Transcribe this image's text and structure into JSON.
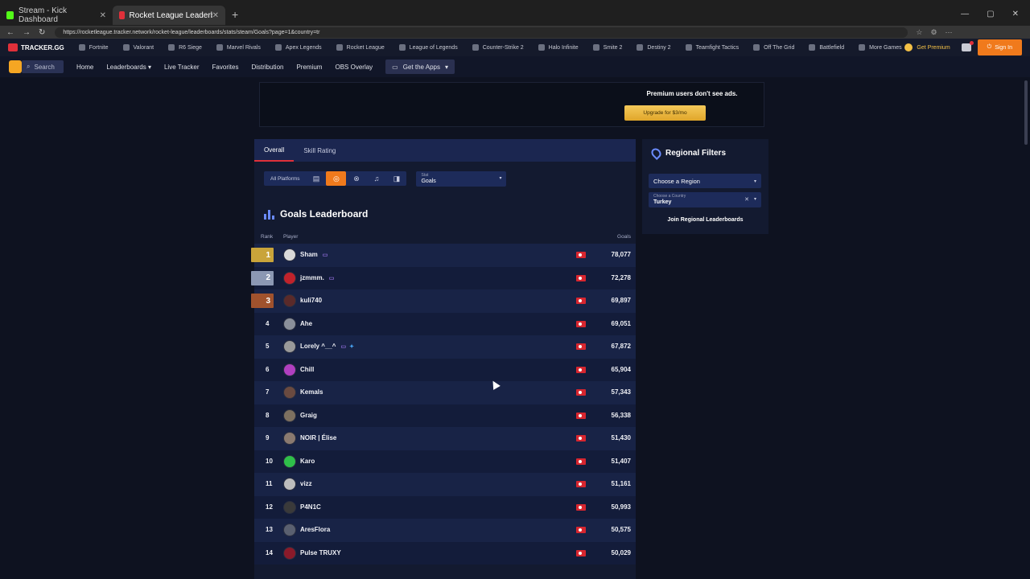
{
  "browser": {
    "tabs": [
      {
        "title": "Stream - Kick Dashboard",
        "color": "#53fc18",
        "active": false
      },
      {
        "title": "Rocket League Leaderboard - Go...",
        "color": "#e0303a",
        "active": true
      }
    ],
    "url": "https://rocketleague.tracker.network/rocket-league/leaderboards/stats/steam/Goals?page=1&country=tr"
  },
  "gamesbar": {
    "logo": "TRACKER.GG",
    "games": [
      "Fortnite",
      "Valorant",
      "R6 Siege",
      "Marvel Rivals",
      "Apex Legends",
      "Rocket League",
      "League of Legends",
      "Counter-Strike 2",
      "Halo Infinite",
      "Smite 2",
      "Destiny 2",
      "Teamfight Tactics",
      "Off The Grid",
      "Battlefield",
      "More Games"
    ],
    "get_premium": "Get Premium",
    "sign_in": "Sign In"
  },
  "mainnav": {
    "search": "Search",
    "items": [
      "Home",
      "Leaderboards",
      "Live Tracker",
      "Favorites",
      "Distribution",
      "Premium",
      "OBS Overlay"
    ],
    "get_apps": "Get the Apps"
  },
  "ad": {
    "text": "Premium users don't see ads.",
    "button": "Upgrade for $3/mo"
  },
  "panel": {
    "tabs": [
      "Overall",
      "Skill Rating"
    ],
    "all_platforms": "All Platforms",
    "stat_label": "Stat",
    "stat_value": "Goals",
    "title": "Goals Leaderboard",
    "columns": {
      "rank": "Rank",
      "player": "Player",
      "value": "Goals"
    },
    "rows": [
      {
        "rank": "1",
        "name": "Sham",
        "value": "78,077",
        "medal": "gold",
        "avatar": "#d9d9d9"
      },
      {
        "rank": "2",
        "name": "jzmmm.",
        "value": "72,278",
        "medal": "silver",
        "avatar": "#c0222b"
      },
      {
        "rank": "3",
        "name": "kuli740",
        "value": "69,897",
        "medal": "bronze",
        "avatar": "#5a2a2a"
      },
      {
        "rank": "4",
        "name": "Ahe",
        "value": "69,051",
        "medal": "",
        "avatar": "#8a8f9a"
      },
      {
        "rank": "5",
        "name": "Lorely ^__^",
        "value": "67,872",
        "medal": "",
        "avatar": "#9a9a9a"
      },
      {
        "rank": "6",
        "name": "Chill",
        "value": "65,904",
        "medal": "",
        "avatar": "#b03fc0"
      },
      {
        "rank": "7",
        "name": "Kemals",
        "value": "57,343",
        "medal": "",
        "avatar": "#6a4a40"
      },
      {
        "rank": "8",
        "name": "Graig",
        "value": "56,338",
        "medal": "",
        "avatar": "#7d7060"
      },
      {
        "rank": "9",
        "name": "NOIR | Élise",
        "value": "51,430",
        "medal": "",
        "avatar": "#8a7a70"
      },
      {
        "rank": "10",
        "name": "Karo",
        "value": "51,407",
        "medal": "",
        "avatar": "#2fbf4a"
      },
      {
        "rank": "11",
        "name": "vizz",
        "value": "51,161",
        "medal": "",
        "avatar": "#bdbdbd"
      },
      {
        "rank": "12",
        "name": "P4N1C",
        "value": "50,993",
        "medal": "",
        "avatar": "#3a3a3a"
      },
      {
        "rank": "13",
        "name": "AresFlora",
        "value": "50,575",
        "medal": "",
        "avatar": "#5a6070"
      },
      {
        "rank": "14",
        "name": "Pulse TRUXY",
        "value": "50,029",
        "medal": "",
        "avatar": "#8a1a2a"
      }
    ]
  },
  "regional": {
    "title": "Regional Filters",
    "region_placeholder": "Choose a Region",
    "country_label": "Choose a Country",
    "country_value": "Turkey",
    "join": "Join Regional Leaderboards"
  }
}
